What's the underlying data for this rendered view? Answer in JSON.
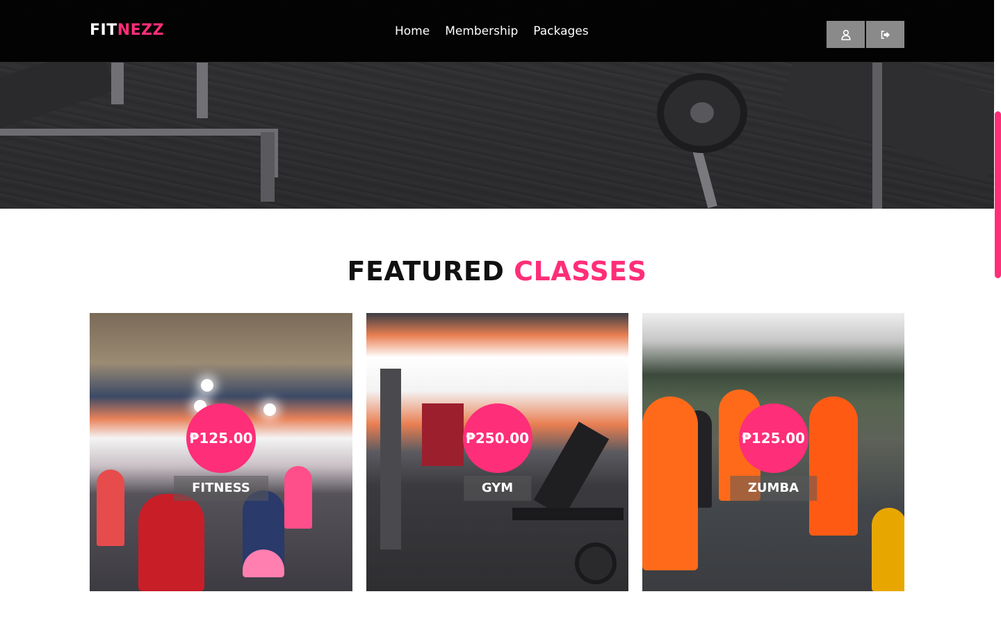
{
  "brand": {
    "part1": "FIT",
    "part2": "NEZZ",
    "accent_color": "#ff2e78"
  },
  "nav": {
    "links": [
      "Home",
      "Membership",
      "Packages"
    ],
    "user_icon": "user-icon",
    "logout_icon": "sign-out-icon"
  },
  "section": {
    "title_part1": "FEATURED",
    "title_part2": "CLASSES"
  },
  "classes": [
    {
      "price": "₱125.00",
      "name": "FITNESS"
    },
    {
      "price": "₱250.00",
      "name": "GYM"
    },
    {
      "price": "₱125.00",
      "name": "ZUMBA"
    }
  ]
}
